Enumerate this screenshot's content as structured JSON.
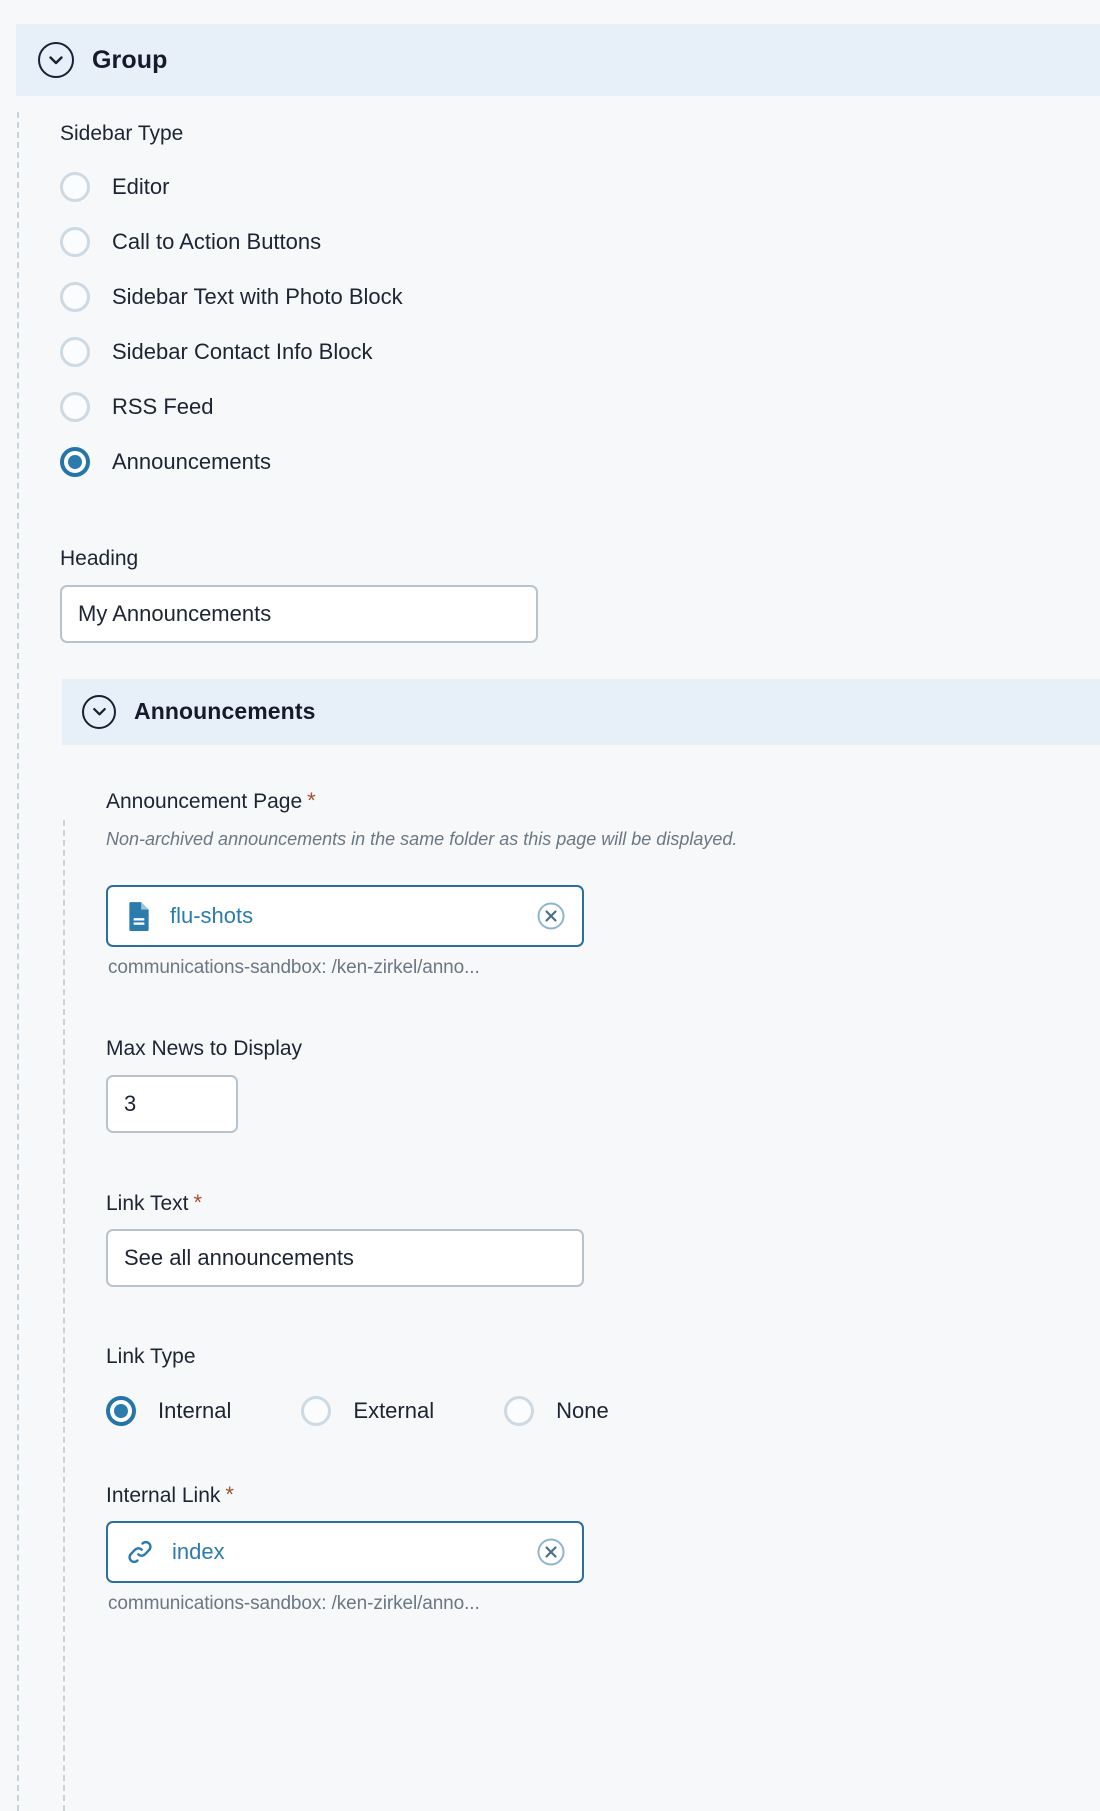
{
  "theme": {
    "page_bg": "#f6f8f9",
    "section_band_bg": "#e7f0f8",
    "accent_blue": "#2b7bad",
    "radio_selected": "#2575a8",
    "required_asterisk": "#a8502d",
    "input_border": "#b9c3cc",
    "chip_border": "#2b6f9c",
    "help_text": "#6b7785",
    "rail_dash": "#c9d3da"
  },
  "group_section": {
    "title": "Group",
    "toggle_icon": "chevron-down-icon",
    "expanded": true
  },
  "sidebar_type": {
    "label": "Sidebar Type",
    "options": [
      {
        "label": "Editor",
        "selected": false
      },
      {
        "label": "Call to Action Buttons",
        "selected": false
      },
      {
        "label": "Sidebar Text with Photo Block",
        "selected": false
      },
      {
        "label": "Sidebar Contact Info Block",
        "selected": false
      },
      {
        "label": "RSS Feed",
        "selected": false
      },
      {
        "label": "Announcements",
        "selected": true
      }
    ],
    "selected_value": "Announcements"
  },
  "heading_field": {
    "label": "Heading",
    "value": "My Announcements",
    "placeholder": ""
  },
  "announcements_section": {
    "title": "Announcements",
    "toggle_icon": "chevron-down-icon",
    "expanded": true
  },
  "announcement_page": {
    "label": "Announcement Page",
    "required_marker": "*",
    "help_text": "Non-archived announcements in the same folder as this page will be displayed.",
    "chip": {
      "icon": "document-icon",
      "label": "flu-shots",
      "clear_icon": "clear-circle-icon"
    },
    "path": "communications-sandbox: /ken-zirkel/anno..."
  },
  "max_news": {
    "label": "Max News to Display",
    "value": "3",
    "placeholder": ""
  },
  "link_text": {
    "label": "Link Text",
    "required_marker": "*",
    "value": "See all announcements",
    "placeholder": ""
  },
  "link_type": {
    "label": "Link Type",
    "options": [
      {
        "label": "Internal",
        "selected": true
      },
      {
        "label": "External",
        "selected": false
      },
      {
        "label": "None",
        "selected": false
      }
    ],
    "selected_value": "Internal"
  },
  "internal_link": {
    "label": "Internal Link",
    "required_marker": "*",
    "chip": {
      "icon": "link-chain-icon",
      "label": "index",
      "clear_icon": "clear-circle-icon"
    },
    "path": "communications-sandbox: /ken-zirkel/anno..."
  }
}
